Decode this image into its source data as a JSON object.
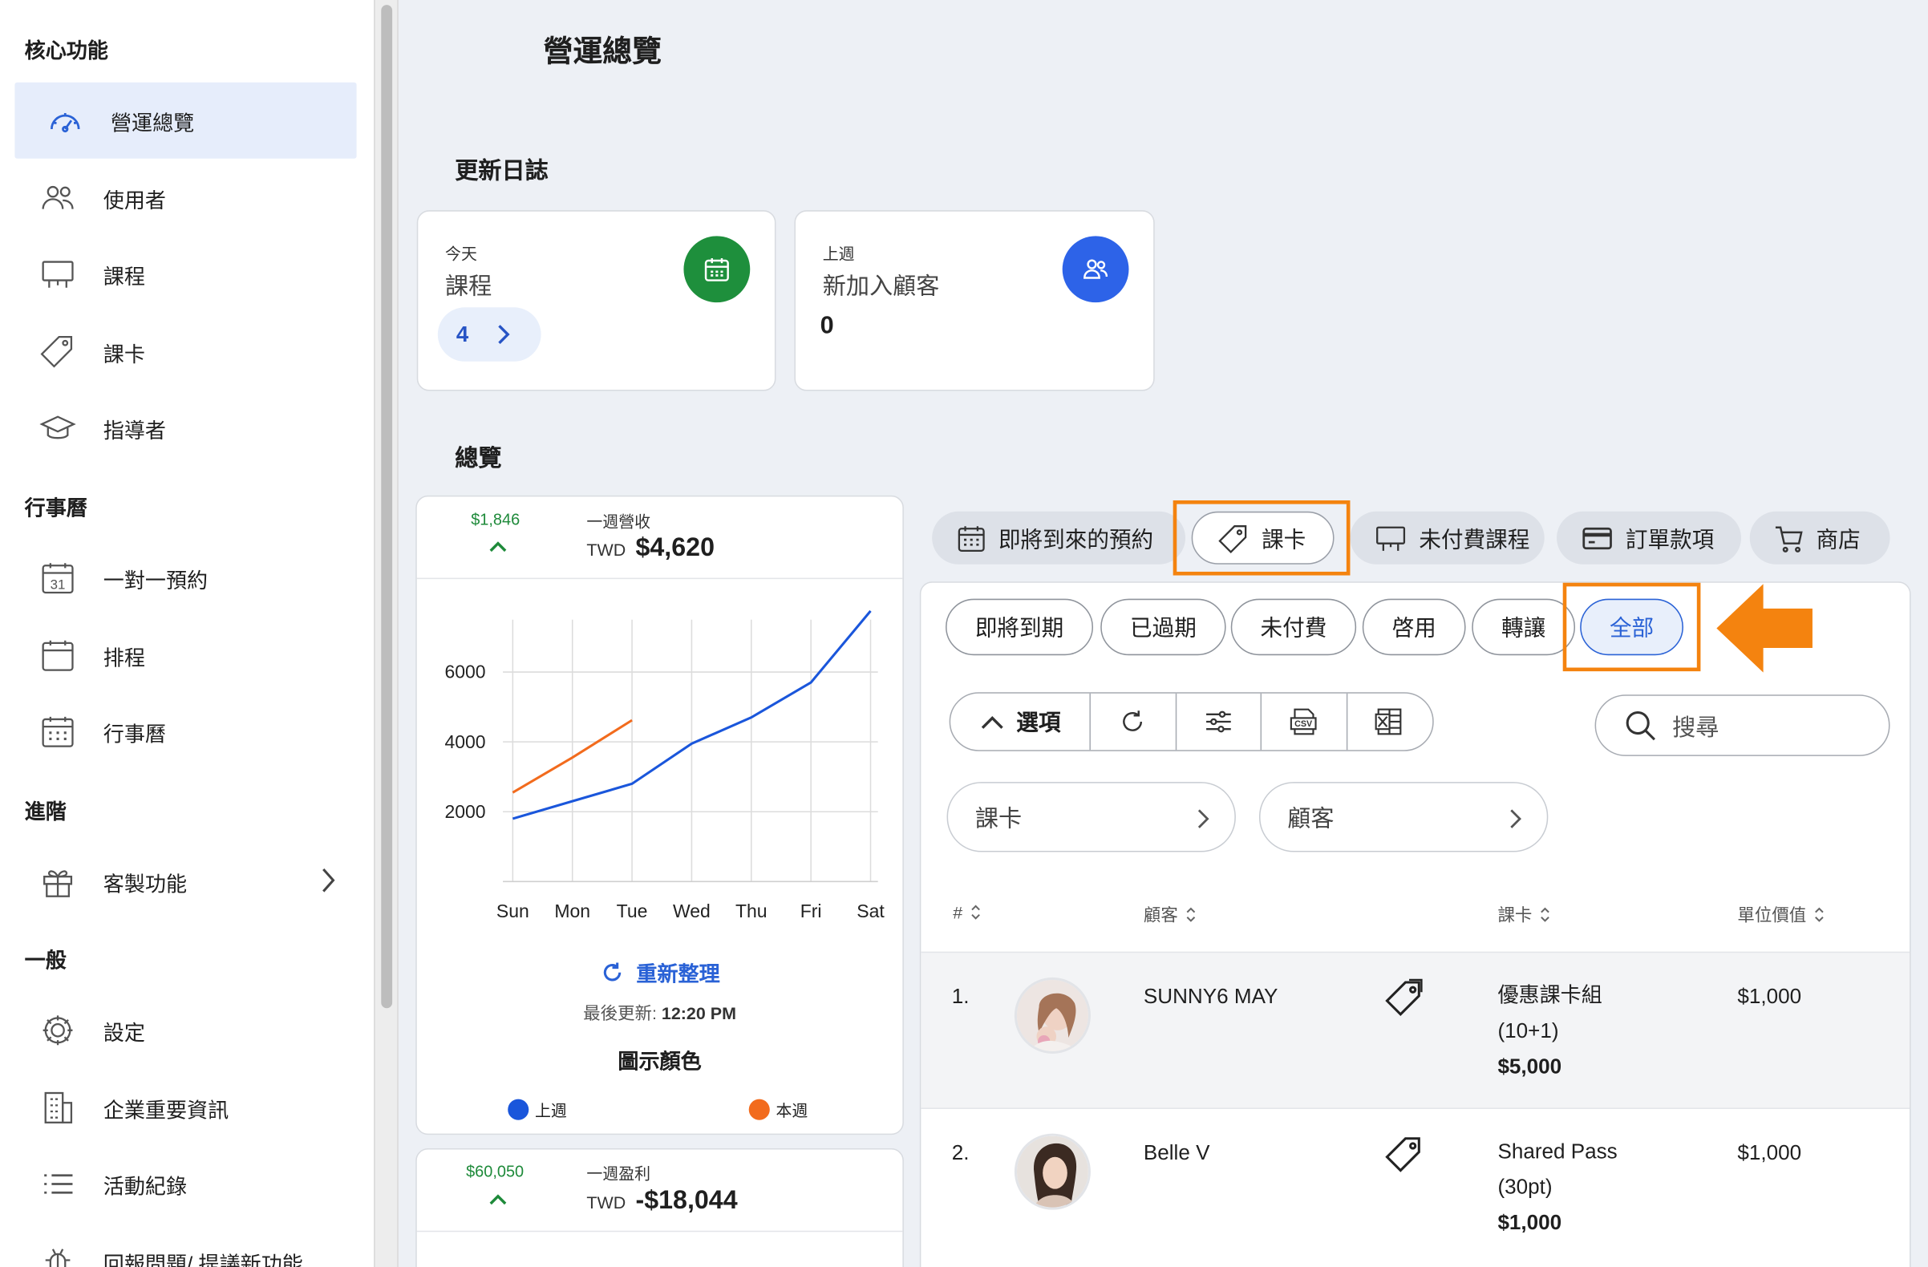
{
  "sidebar": {
    "sections": {
      "core": "核心功能",
      "calendar": "行事曆",
      "advanced": "進階",
      "general": "一般"
    },
    "items": {
      "overview": "營運總覽",
      "users": "使用者",
      "courses": "課程",
      "passes": "課卡",
      "instructors": "指導者",
      "one_on_one": "一對一預約",
      "schedule": "排程",
      "calendar": "行事曆",
      "custom": "客製功能",
      "settings": "設定",
      "business_info": "企業重要資訊",
      "activity_log": "活動紀錄",
      "feedback": "回報問題/ 提議新功能"
    }
  },
  "main": {
    "title": "營運總覽",
    "changelog_title": "更新日誌",
    "overview_title": "總覽",
    "cards": {
      "today": {
        "small": "今天",
        "label": "課程",
        "count": "4"
      },
      "last_week": {
        "small": "上週",
        "label": "新加入顧客",
        "count": "0"
      }
    },
    "revenue": {
      "delta": "$1,846",
      "label": "一週營收",
      "currency": "TWD",
      "value": "$4,620",
      "refresh": "重新整理",
      "updated_prefix": "最後更新:",
      "updated_time": "12:20 PM",
      "legend_title": "圖示顏色",
      "legend_last": "上週",
      "legend_this": "本週"
    },
    "profit": {
      "delta": "$60,050",
      "label": "一週盈利",
      "currency": "TWD",
      "value": "-$18,044"
    }
  },
  "chart_data": {
    "type": "line",
    "categories": [
      "Sun",
      "Mon",
      "Tue",
      "Wed",
      "Thu",
      "Fri",
      "Sat"
    ],
    "yticks": [
      2000,
      4000,
      6000
    ],
    "ylim": [
      0,
      7500
    ],
    "grid": true,
    "series": [
      {
        "name": "上週",
        "color": "#1a56db",
        "values": [
          1800,
          2300,
          2800,
          3950,
          4700,
          5700,
          7750
        ]
      },
      {
        "name": "本週",
        "color": "#f26b1d",
        "values": [
          2550,
          3550,
          4620
        ]
      }
    ]
  },
  "tabs": {
    "upcoming": "即將到來的預約",
    "passes": "課卡",
    "unpaid": "未付費課程",
    "orders": "訂單款項",
    "shop": "商店"
  },
  "filters": {
    "expiring": "即將到期",
    "expired": "已過期",
    "unpaid": "未付費",
    "active": "啓用",
    "transfer": "轉讓",
    "all": "全部"
  },
  "toolbar": {
    "options": "選項",
    "search_placeholder": "搜尋"
  },
  "dropdowns": {
    "pass": "課卡",
    "customer": "顧客"
  },
  "table": {
    "headers": {
      "num": "#",
      "customer": "顧客",
      "pass": "課卡",
      "unit": "單位價值"
    },
    "rows": [
      {
        "num": "1.",
        "name": "SUNNY6 MAY",
        "pass_line1": "優惠課卡組",
        "pass_line2": "(10+1)",
        "price": "$5,000",
        "unit": "$1,000"
      },
      {
        "num": "2.",
        "name": "Belle V",
        "pass_line1": "Shared Pass",
        "pass_line2": "(30pt)",
        "price": "$1,000",
        "unit": "$1,000"
      }
    ]
  },
  "colors": {
    "accent": "#2a62d6",
    "highlight": "#f4830f",
    "green": "#1e8a3a"
  }
}
